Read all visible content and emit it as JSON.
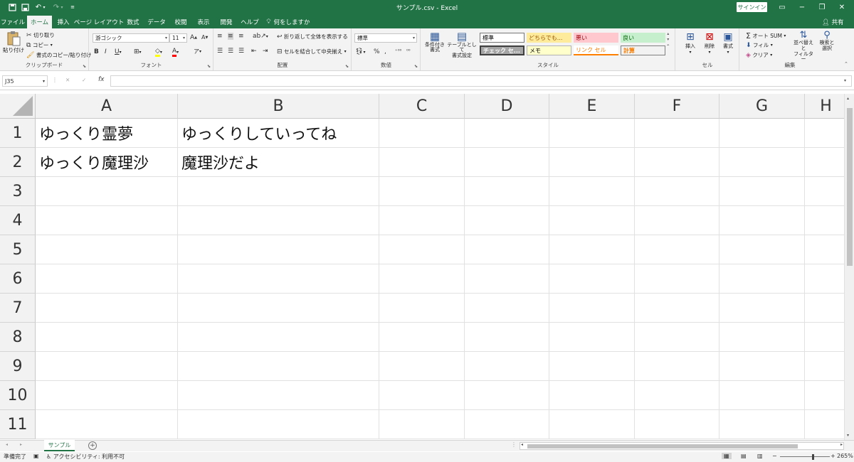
{
  "window": {
    "title": "サンプル.csv  -  Excel",
    "signin": "サインイン",
    "share": "共有"
  },
  "tabs": [
    {
      "label": "ファイル",
      "active": false
    },
    {
      "label": "ホーム",
      "active": true
    },
    {
      "label": "挿入",
      "active": false
    },
    {
      "label": "ページ レイアウト",
      "active": false
    },
    {
      "label": "数式",
      "active": false
    },
    {
      "label": "データ",
      "active": false
    },
    {
      "label": "校閲",
      "active": false
    },
    {
      "label": "表示",
      "active": false
    },
    {
      "label": "開発",
      "active": false
    },
    {
      "label": "ヘルプ",
      "active": false
    }
  ],
  "tell_me": "何をしますか",
  "ribbon": {
    "clipboard": {
      "label": "クリップボード",
      "paste": "貼り付け",
      "cut": "切り取り",
      "copy": "コピー",
      "format_painter": "書式のコピー/貼り付け"
    },
    "font": {
      "label": "フォント",
      "font_name": "游ゴシック",
      "font_size": "11"
    },
    "alignment": {
      "label": "配置",
      "wrap_text": "折り返して全体を表示する",
      "merge_center": "セルを結合して中央揃え"
    },
    "number": {
      "label": "数値",
      "format": "標準"
    },
    "styles": {
      "label": "スタイル",
      "conditional": "条件付き\n書式",
      "table": "テーブルとして\n書式設定",
      "cells": [
        {
          "text": "標準",
          "bg": "#ffffff",
          "color": "#000000"
        },
        {
          "text": "どちらでも...",
          "bg": "#ffeb9c",
          "color": "#9c5700"
        },
        {
          "text": "悪い",
          "bg": "#ffc7ce",
          "color": "#9c0006"
        },
        {
          "text": "良い",
          "bg": "#c6efce",
          "color": "#006100"
        },
        {
          "text": "チェック セ...",
          "bg": "#a5a5a5",
          "color": "#ffffff"
        },
        {
          "text": "メモ",
          "bg": "#ffffcc",
          "color": "#000000"
        },
        {
          "text": "リンク セル",
          "bg": "#ffffff",
          "color": "#fa7d00"
        },
        {
          "text": "計算",
          "bg": "#f2f2f2",
          "color": "#fa7d00"
        }
      ]
    },
    "cells": {
      "label": "セル",
      "insert": "挿入",
      "delete": "削除",
      "format": "書式"
    },
    "editing": {
      "label": "編集",
      "autosum": "オート SUM",
      "fill": "フィル",
      "clear": "クリア",
      "sort_filter": "並べ替えと\nフィルター",
      "find_select": "検索と\n選択"
    }
  },
  "formula_bar": {
    "name_box": "J35",
    "fx": "fx",
    "value": ""
  },
  "grid": {
    "columns": [
      "A",
      "B",
      "C",
      "D",
      "E",
      "F",
      "G",
      "H"
    ],
    "rows": [
      "1",
      "2",
      "3",
      "4",
      "5",
      "6",
      "7",
      "8",
      "9",
      "10",
      "11"
    ],
    "cells": [
      [
        "ゆっくり霊夢",
        "ゆっくりしていってね"
      ],
      [
        "ゆっくり魔理沙",
        "魔理沙だよ"
      ]
    ]
  },
  "sheets": [
    {
      "name": "サンプル",
      "active": true
    }
  ],
  "status": {
    "ready": "準備完了",
    "accessibility": "アクセシビリティ: 利用不可",
    "zoom": "265%"
  },
  "colors": {
    "brand": "#217346",
    "ribbon_bg": "#f3f3f3",
    "header_bg": "#f2f2f2",
    "gridline": "#e1e1e1"
  }
}
